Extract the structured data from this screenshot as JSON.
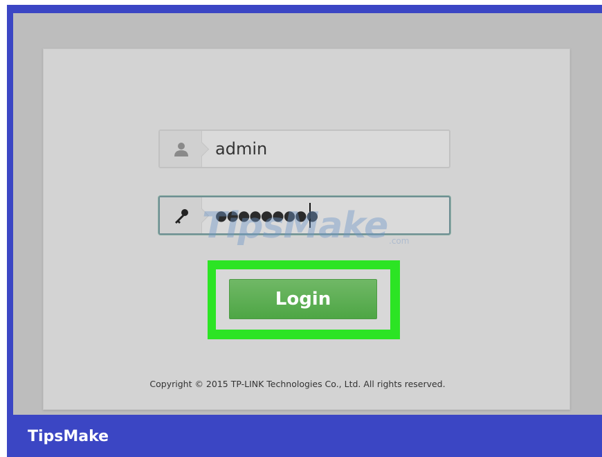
{
  "login_form": {
    "username_value": "admin",
    "password_mask": "●●●●●●●●●",
    "login_label": "Login"
  },
  "footer": {
    "copyright": "Copyright © 2015 TP-LINK Technologies Co., Ltd. All rights reserved."
  },
  "watermark": {
    "text": "TipsMake",
    "suffix": ".com"
  },
  "branding": {
    "label": "TipsMake"
  },
  "icons": {
    "username": "user-icon",
    "password": "key-icon"
  },
  "colors": {
    "frame": "#3b46c4",
    "highlight": "#2ce424",
    "login_button": "#5aae50"
  }
}
